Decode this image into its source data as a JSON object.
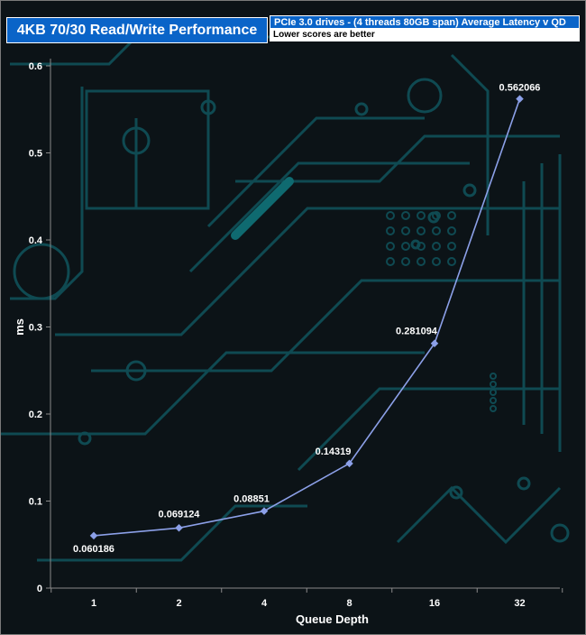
{
  "chart_data": {
    "type": "line",
    "title": "4KB 70/30 Read/Write Performance",
    "legend_series": "PCIe 3.0 drives - (4 threads 80GB span) Average Latency v QD",
    "legend_note": "Lower scores are better",
    "xlabel": "Queue Depth",
    "ylabel": "ms",
    "categories": [
      "1",
      "2",
      "4",
      "8",
      "16",
      "32"
    ],
    "series": [
      {
        "values": [
          0.060186,
          0.069124,
          0.08851,
          0.14319,
          0.281094,
          0.562066
        ],
        "labels": [
          "0.060186",
          "0.069124",
          "0.08851",
          "0.14319",
          "0.281094",
          "0.562066"
        ],
        "color": "#8ca0e8"
      }
    ],
    "ylim": [
      0,
      0.6
    ],
    "yticks": [
      "0",
      "0.1",
      "0.2",
      "0.3",
      "0.4",
      "0.5",
      "0.6"
    ],
    "grid": false,
    "colors": {
      "title_bg": "#0a64c8",
      "axis": "#8a8a8a",
      "text": "#ffffff"
    }
  }
}
